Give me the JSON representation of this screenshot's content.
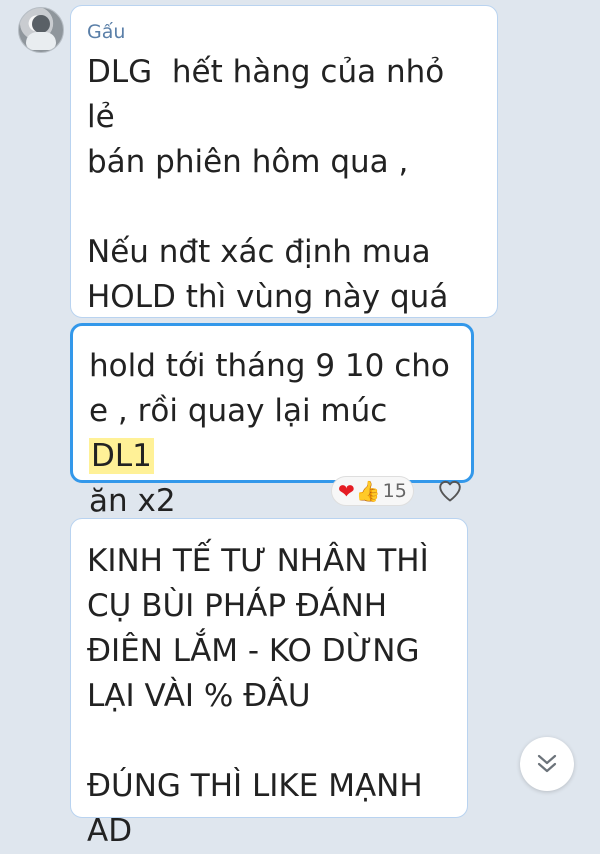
{
  "chat": {
    "sender_name": "Gấu",
    "messages": [
      {
        "text": "DLG  hết hàng của nhỏ lẻ\nbán phiên hôm qua ,\n\nNếu nđt xác định mua\nHOLD thì vùng này quá\nngon để mua dài"
      },
      {
        "text_before": "hold tới tháng 9 10 cho\ne , rồi quay lại múc ",
        "highlight": "DL1",
        "text_after": "\năn x2",
        "reaction_count": "15"
      },
      {
        "text": "KINH TẾ TƯ NHÂN THÌ\nCỤ BÙI PHÁP ĐÁNH\nĐIÊN LẮM - KO DỪNG\nLẠI VÀI % ĐÂU\n\nĐÚNG THÌ LIKE MẠNH\nAD"
      }
    ]
  },
  "icons": {
    "avatar": "avatar",
    "heart": "heart-emoji",
    "like": "thumbs-up-emoji",
    "reaction_button": "heart-outline-icon",
    "scroll_down": "double-chevron-down-icon"
  },
  "colors": {
    "background": "#dfe6ee",
    "bubble": "#ffffff",
    "sender": "#5a7fa8",
    "active_border": "#3398ea",
    "highlight": "#fff197",
    "heart": "#e51c23",
    "like": "#f2b126"
  }
}
